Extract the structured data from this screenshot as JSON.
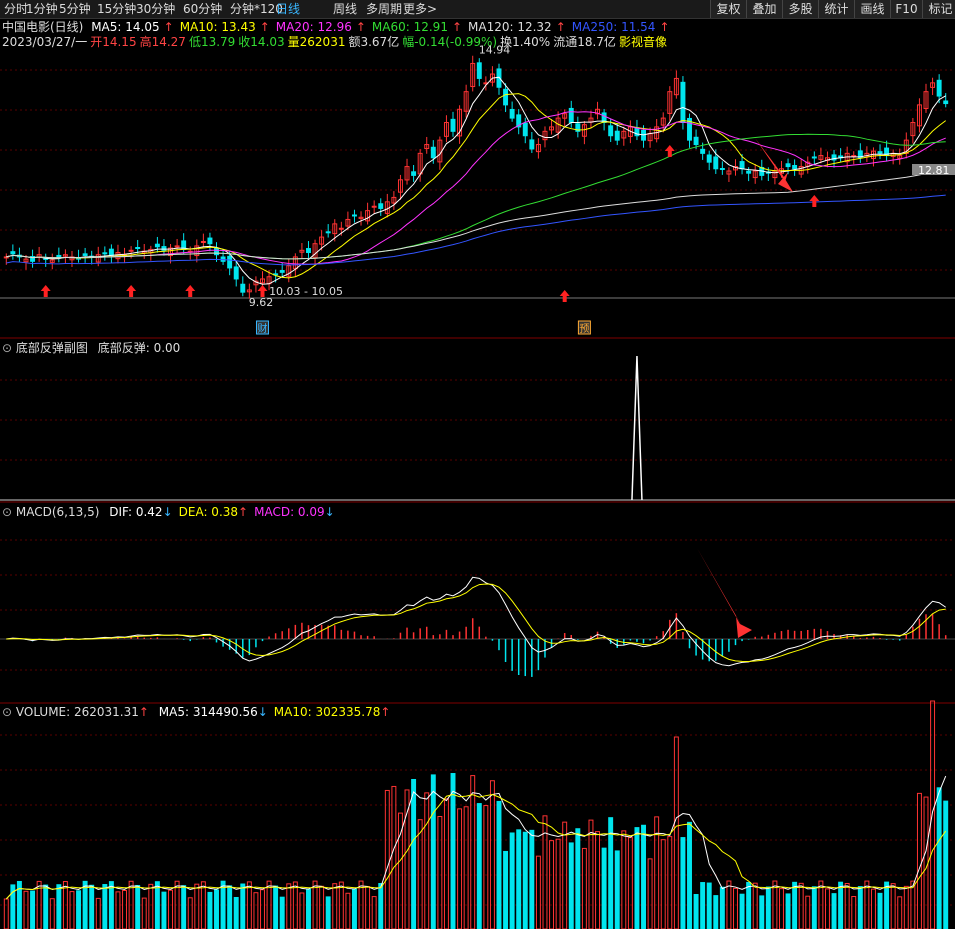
{
  "toolbar": {
    "tabs": [
      "分时",
      "1分钟",
      "5分钟",
      "15分钟",
      "30分钟",
      "60分钟",
      "分钟*120",
      "日线",
      "周线",
      "多周期",
      "更多>"
    ],
    "active_tab": "日线",
    "right_buttons": [
      "复权",
      "叠加",
      "多股",
      "统计",
      "画线",
      "F10",
      "标记"
    ]
  },
  "main_panel": {
    "stock_name": "中国电影(日线)",
    "ma_legend": [
      {
        "label": "MA5: 14.05",
        "color": "#ffffff",
        "arrow": "↑"
      },
      {
        "label": "MA10: 13.43",
        "color": "#ffff00",
        "arrow": "↑"
      },
      {
        "label": "MA20: 12.96",
        "color": "#ff33ff",
        "arrow": "↑"
      },
      {
        "label": "MA60: 12.91",
        "color": "#33dd33",
        "arrow": "↑"
      },
      {
        "label": "MA120: 12.32",
        "color": "#dddddd",
        "arrow": "↑"
      },
      {
        "label": "MA250: 11.54",
        "color": "#3355ff",
        "arrow": "↑"
      }
    ],
    "quote_line": [
      {
        "text": "2023/03/27/一",
        "color": "#dddddd"
      },
      {
        "text": "开14.15",
        "color": "#ff4444"
      },
      {
        "text": "高14.27",
        "color": "#ff4444"
      },
      {
        "text": "低13.79",
        "color": "#33dd33"
      },
      {
        "text": "收14.03",
        "color": "#33dd33"
      },
      {
        "text": "量262031",
        "color": "#ffff00"
      },
      {
        "text": "额3.67亿",
        "color": "#dddddd"
      },
      {
        "text": "幅-0.14(-0.99%)",
        "color": "#33dd33"
      },
      {
        "text": "换1.40%",
        "color": "#dddddd"
      },
      {
        "text": "流通18.7亿",
        "color": "#dddddd"
      },
      {
        "text": "影视音像",
        "color": "#ffff00"
      }
    ],
    "annotations": {
      "high": "14.94",
      "low": "9.62",
      "range": "10.03 - 10.05",
      "last": "12.81"
    },
    "markers": {
      "fin": "财",
      "pre": "预"
    }
  },
  "sub_panel": {
    "title": "底部反弹副图",
    "value_label": "底部反弹: 0.00"
  },
  "macd_panel": {
    "title": "MACD(6,13,5)",
    "dif": {
      "label": "DIF: 0.42",
      "arrow": "↓",
      "color": "#ffffff"
    },
    "dea": {
      "label": "DEA: 0.38",
      "arrow": "↑",
      "color": "#ffff00"
    },
    "macd": {
      "label": "MACD: 0.09",
      "arrow": "↓",
      "color": "#ff33ff"
    }
  },
  "volume_panel": {
    "title": "VOLUME: 262031.31",
    "ma5": {
      "label": "MA5: 314490.56",
      "arrow": "↓"
    },
    "ma10": {
      "label": "MA10: 302335.78",
      "arrow": "↑"
    }
  },
  "colors": {
    "up": "#ff3333",
    "down": "#00e5ee",
    "grid": "#5a0000"
  },
  "chart_data": {
    "type": "candlestick",
    "price_range": [
      9.62,
      14.94
    ],
    "closes": [
      10.55,
      10.62,
      10.55,
      10.5,
      10.45,
      10.6,
      10.5,
      10.48,
      10.52,
      10.6,
      10.55,
      10.5,
      10.58,
      10.55,
      10.6,
      10.62,
      10.58,
      10.65,
      10.6,
      10.7,
      10.75,
      10.68,
      10.72,
      10.78,
      10.7,
      10.75,
      10.8,
      10.72,
      10.68,
      10.8,
      10.9,
      10.85,
      10.6,
      10.45,
      10.3,
      10.05,
      9.75,
      9.8,
      10.0,
      10.05,
      10.1,
      10.15,
      10.2,
      10.35,
      10.55,
      10.7,
      10.65,
      10.85,
      11.0,
      11.1,
      11.3,
      11.2,
      11.4,
      11.5,
      11.45,
      11.6,
      11.7,
      11.65,
      11.8,
      11.9,
      12.3,
      12.6,
      12.4,
      12.9,
      13.1,
      12.8,
      13.2,
      13.6,
      13.4,
      13.9,
      14.3,
      14.94,
      14.6,
      14.5,
      14.7,
      14.4,
      14.0,
      13.7,
      13.5,
      13.3,
      13.0,
      13.1,
      13.4,
      13.5,
      13.7,
      13.8,
      13.6,
      13.4,
      13.55,
      13.7,
      13.9,
      13.6,
      13.3,
      13.2,
      13.4,
      13.5,
      13.3,
      13.2,
      13.35,
      13.5,
      13.7,
      14.3,
      14.6,
      13.6,
      13.2,
      13.1,
      12.9,
      12.7,
      12.55,
      12.55,
      12.5,
      12.6,
      12.55,
      12.45,
      12.5,
      12.4,
      12.45,
      12.5,
      12.55,
      12.6,
      12.55,
      12.6,
      12.7,
      12.8,
      12.85,
      12.8,
      12.75,
      12.8,
      12.9,
      12.85,
      12.8,
      12.9,
      12.95,
      12.9,
      12.85,
      12.9,
      12.85,
      13.2,
      13.6,
      14.0,
      14.3,
      14.5,
      14.2,
      14.03
    ],
    "bottom_rebound": {
      "value": 0.0,
      "spike_value": 1
    }
  }
}
